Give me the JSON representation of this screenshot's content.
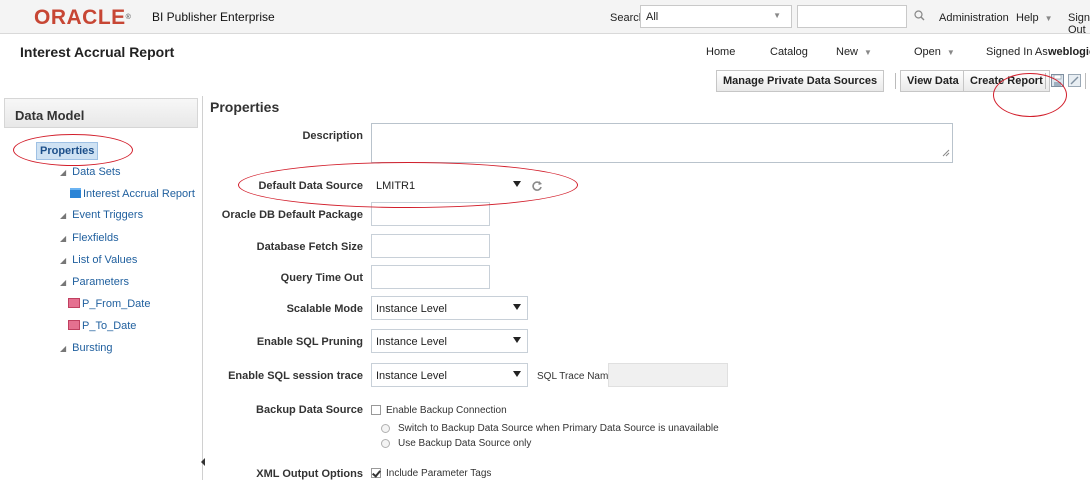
{
  "topbar": {
    "logo_text": "ORACLE",
    "logo_mark": "®",
    "product": "BI Publisher Enterprise",
    "search_label": "Search",
    "search_scope": "All",
    "search_value": "",
    "administration": "Administration",
    "help": "Help",
    "sign_out": "Sign Out"
  },
  "header": {
    "report_title": "Interest Accrual Report",
    "home": "Home",
    "catalog": "Catalog",
    "new": "New",
    "open": "Open",
    "signed_in_as": "Signed In As",
    "user": "weblogic"
  },
  "toolbar": {
    "manage_private": "Manage Private Data Sources",
    "view_data": "View Data",
    "create_report": "Create Report"
  },
  "left_panel": {
    "title": "Data Model",
    "items": {
      "properties": "Properties",
      "data_sets": "Data Sets",
      "data_set_1": "Interest Accrual Report",
      "event_triggers": "Event Triggers",
      "flexfields": "Flexfields",
      "list_of_values": "List of Values",
      "parameters": "Parameters",
      "param_1": "P_From_Date",
      "param_2": "P_To_Date",
      "bursting": "Bursting"
    }
  },
  "main": {
    "title": "Properties",
    "description_label": "Description",
    "description_value": "",
    "default_ds_label": "Default Data Source",
    "default_ds_value": "LMITR1",
    "oracle_pkg_label": "Oracle DB Default Package",
    "oracle_pkg_value": "",
    "fetch_size_label": "Database Fetch Size",
    "fetch_size_value": "",
    "timeout_label": "Query Time Out",
    "timeout_value": "",
    "scalable_label": "Scalable Mode",
    "scalable_value": "Instance Level",
    "pruning_label": "Enable SQL Pruning",
    "pruning_value": "Instance Level",
    "trace_label": "Enable SQL session trace",
    "trace_value": "Instance Level",
    "trace_name_label": "SQL Trace Name",
    "trace_name_value": "",
    "backup_label": "Backup Data Source",
    "backup_enable": "Enable Backup Connection",
    "backup_opt1": "Switch to Backup Data Source when Primary Data Source is unavailable",
    "backup_opt2": "Use Backup Data Source only",
    "xml_label": "XML Output Options",
    "xml_include": "Include Parameter Tags"
  },
  "colors": {
    "oracle_red": "#c74634",
    "annotation_red": "#d21e2b",
    "link_blue": "#1f5f9e"
  }
}
